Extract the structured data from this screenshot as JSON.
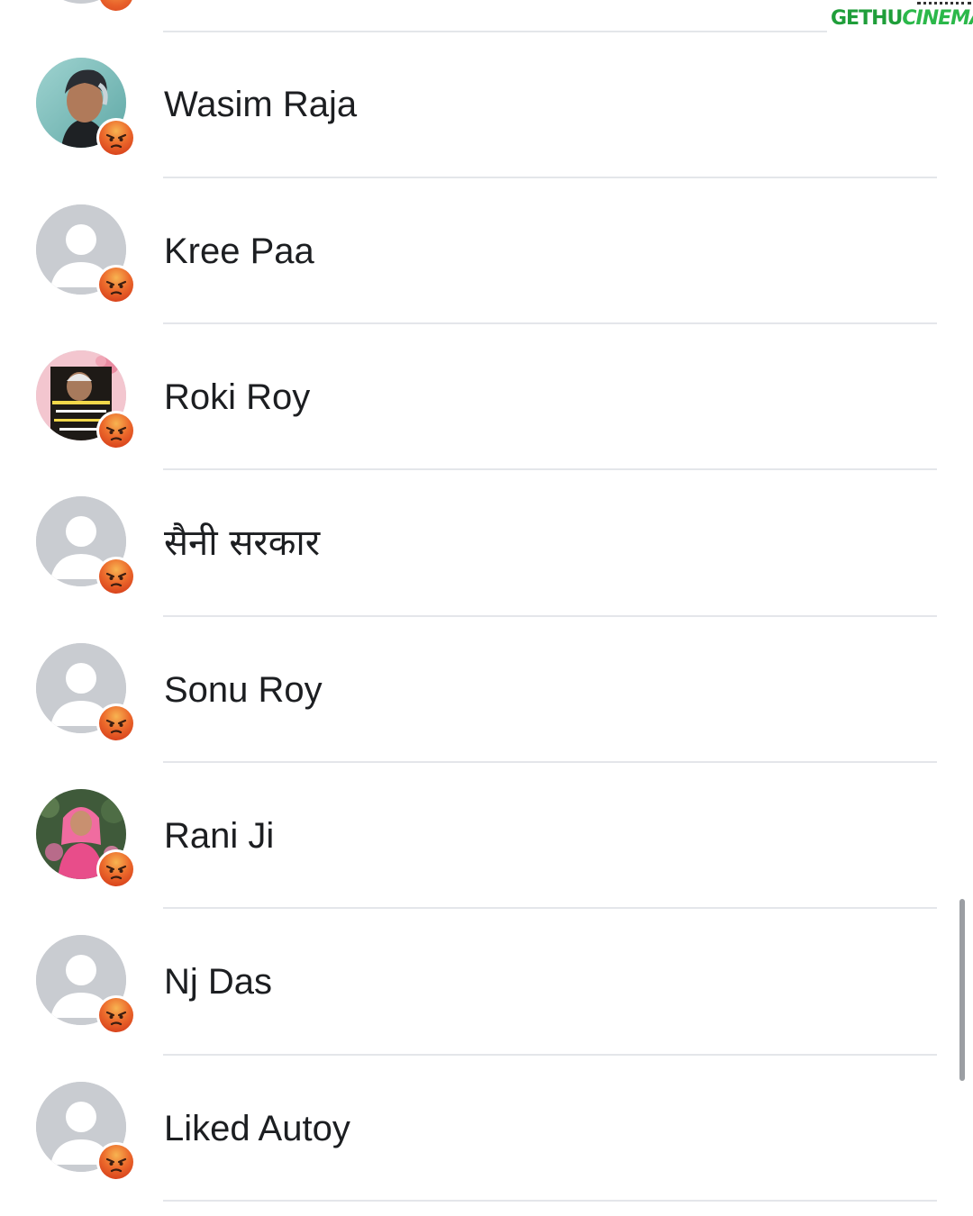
{
  "watermark": {
    "part1": "GETHU",
    "part2": "CINEMA"
  },
  "contacts": [
    {
      "name": "Wasim Raja",
      "avatar": "photo-man",
      "reaction": "angry-icon"
    },
    {
      "name": "Kree Paa",
      "avatar": "default-avatar",
      "reaction": "angry-icon"
    },
    {
      "name": "Roki Roy",
      "avatar": "photo-quote",
      "reaction": "angry-icon"
    },
    {
      "name": "सैनी सरकार",
      "avatar": "default-avatar",
      "reaction": "angry-icon"
    },
    {
      "name": "Sonu Roy",
      "avatar": "default-avatar",
      "reaction": "angry-icon"
    },
    {
      "name": "Rani Ji",
      "avatar": "photo-woman",
      "reaction": "angry-icon"
    },
    {
      "name": "Nj Das",
      "avatar": "default-avatar",
      "reaction": "angry-icon"
    },
    {
      "name": "Liked Autoy",
      "avatar": "default-avatar",
      "reaction": "angry-icon"
    }
  ],
  "colors": {
    "angry_reaction": "#e8602a",
    "default_avatar_bg": "#c9ccd1",
    "divider": "#e4e6ea",
    "text": "#1c1e21"
  }
}
